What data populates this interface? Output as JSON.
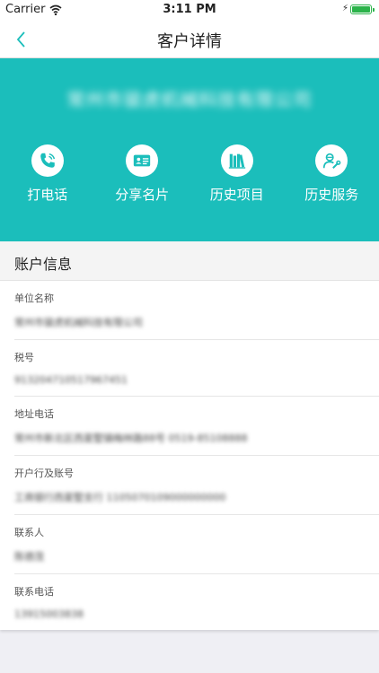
{
  "status_bar": {
    "carrier": "Carrier",
    "time": "3:11 PM"
  },
  "nav": {
    "title": "客户详情"
  },
  "header": {
    "company_name": "常州市骏虎机械科技有限公司",
    "actions": [
      {
        "label": "打电话",
        "icon": "phone-icon"
      },
      {
        "label": "分享名片",
        "icon": "id-card-icon"
      },
      {
        "label": "历史项目",
        "icon": "books-icon"
      },
      {
        "label": "历史服务",
        "icon": "service-person-icon"
      }
    ]
  },
  "account": {
    "section_title": "账户信息",
    "fields": [
      {
        "label": "单位名称",
        "value": "常州市骏虎机械科技有限公司"
      },
      {
        "label": "税号",
        "value": "913204710517967451"
      },
      {
        "label": "地址电话",
        "value": "常州市新北区西夏墅镇梅林路88号 0519-85108888"
      },
      {
        "label": "开户行及账号",
        "value": "工商银行西夏墅支行 1105070109000000000"
      },
      {
        "label": "联系人",
        "value": "陈德茂"
      },
      {
        "label": "联系电话",
        "value": "13915003838"
      }
    ]
  },
  "colors": {
    "accent": "#1bbebb",
    "battery": "#2bb34a"
  }
}
